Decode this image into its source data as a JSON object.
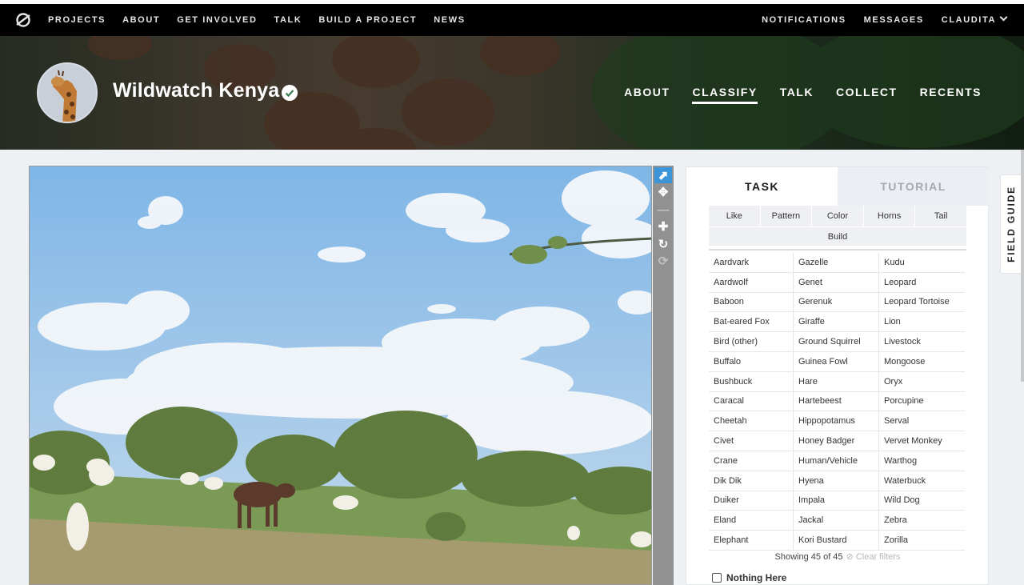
{
  "topnav": {
    "links": [
      "PROJECTS",
      "ABOUT",
      "GET INVOLVED",
      "TALK",
      "BUILD A PROJECT",
      "NEWS"
    ],
    "right": {
      "notifications": "NOTIFICATIONS",
      "messages": "MESSAGES",
      "user": "CLAUDITA"
    }
  },
  "project": {
    "title": "Wildwatch Kenya",
    "tabs": [
      "ABOUT",
      "CLASSIFY",
      "TALK",
      "COLLECT",
      "RECENTS"
    ],
    "active_tab": "CLASSIFY"
  },
  "toolbar": {
    "icons": [
      "pointer-icon",
      "move-icon",
      "zoom-out-icon",
      "zoom-in-icon",
      "rotate-icon",
      "reset-icon"
    ]
  },
  "panel": {
    "tabs": {
      "task": "TASK",
      "tutorial": "TUTORIAL"
    },
    "filters": [
      "Like",
      "Pattern",
      "Color",
      "Horns",
      "Tail"
    ],
    "build": "Build",
    "species_col1": [
      "Aardvark",
      "Aardwolf",
      "Baboon",
      "Bat-eared Fox",
      "Bird (other)",
      "Buffalo",
      "Bushbuck",
      "Caracal",
      "Cheetah",
      "Civet",
      "Crane",
      "Dik Dik",
      "Duiker",
      "Eland",
      "Elephant"
    ],
    "species_col2": [
      "Gazelle",
      "Genet",
      "Gerenuk",
      "Giraffe",
      "Ground Squirrel",
      "Guinea Fowl",
      "Hare",
      "Hartebeest",
      "Hippopotamus",
      "Honey Badger",
      "Human/Vehicle",
      "Hyena",
      "Impala",
      "Jackal",
      "Kori Bustard"
    ],
    "species_col3": [
      "Kudu",
      "Leopard",
      "Leopard Tortoise",
      "Lion",
      "Livestock",
      "Mongoose",
      "Oryx",
      "Porcupine",
      "Serval",
      "Vervet Monkey",
      "Warthog",
      "Waterbuck",
      "Wild Dog",
      "Zebra",
      "Zorilla"
    ],
    "showing": "Showing 45 of 45",
    "clear_filters": "Clear filters",
    "nothing_here": "Nothing Here"
  },
  "field_guide": "FIELD GUIDE",
  "colors": {
    "nav_bg": "#000000",
    "accent_blue": "#3c95d8",
    "panel_bg": "#ffffff",
    "page_bg": "#eef1f4"
  }
}
